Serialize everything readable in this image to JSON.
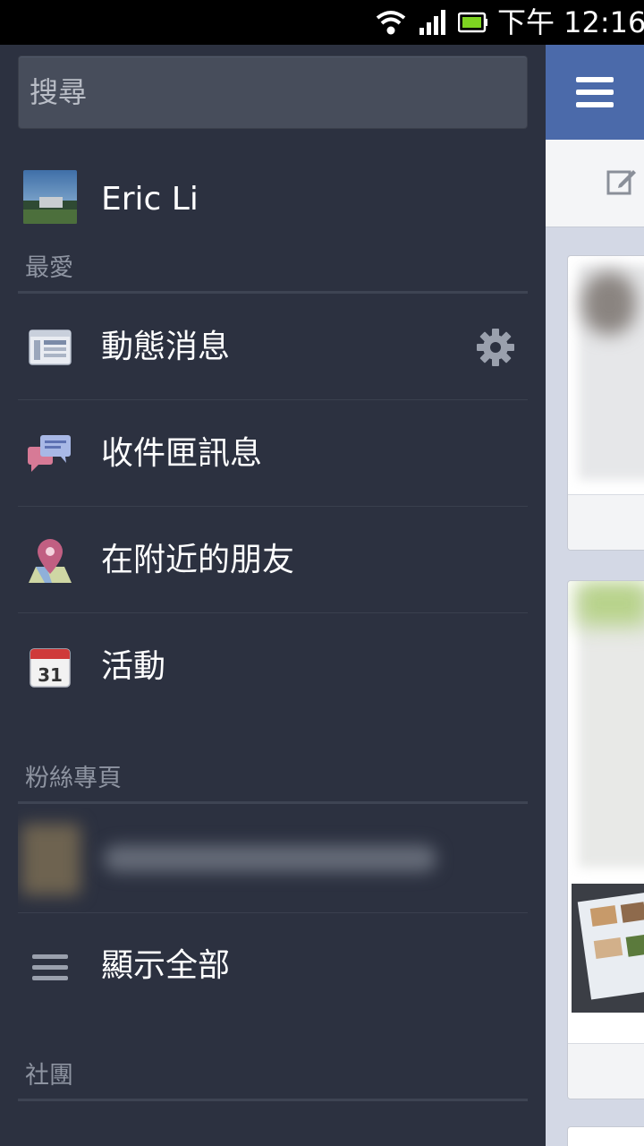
{
  "status_bar": {
    "time": "下午 12:16",
    "icons": [
      "wifi-icon",
      "signal-icon",
      "battery-icon"
    ]
  },
  "drawer": {
    "search": {
      "placeholder": "搜尋"
    },
    "profile": {
      "name": "Eric Li"
    },
    "sections": {
      "favorites": "最愛",
      "pages": "粉絲專頁",
      "groups": "社團"
    },
    "favorites": [
      {
        "label": "動態消息",
        "icon": "news-feed-icon",
        "has_settings": true
      },
      {
        "label": "收件匣訊息",
        "icon": "messages-icon"
      },
      {
        "label": "在附近的朋友",
        "icon": "nearby-pin-icon"
      },
      {
        "label": "活動",
        "icon": "calendar-icon",
        "icon_text": "31"
      }
    ],
    "show_all": {
      "label": "顯示全部",
      "icon": "list-icon"
    }
  },
  "colors": {
    "drawer_bg": "#2c3140",
    "search_bg": "#474d5b",
    "facebook_blue": "#4b6aaa",
    "section_text": "#8e94a1"
  }
}
